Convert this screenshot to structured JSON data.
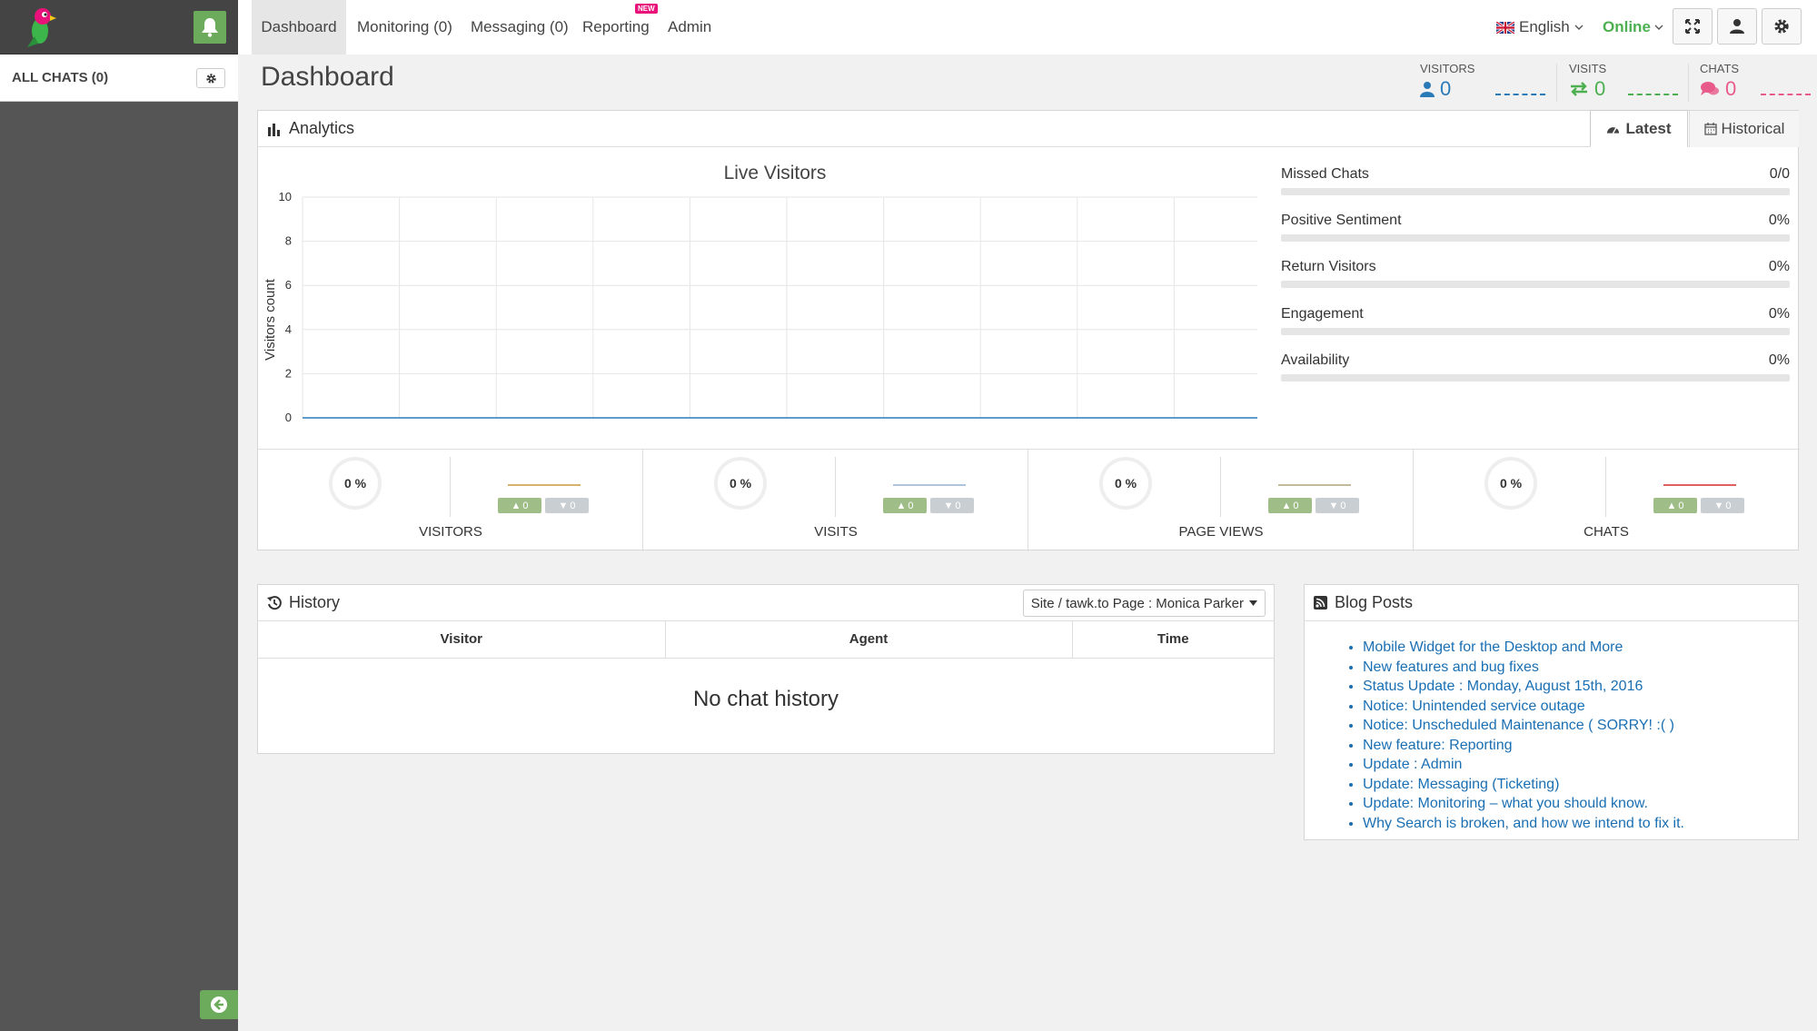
{
  "sidebar": {
    "all_chats_label": "ALL CHATS (0)"
  },
  "nav": {
    "tabs": [
      {
        "label": "Dashboard"
      },
      {
        "label": "Monitoring (0)"
      },
      {
        "label": "Messaging (0)"
      },
      {
        "label": "Reporting"
      },
      {
        "label": "Admin"
      }
    ],
    "new_badge": "NEW",
    "language": "English",
    "status": "Online"
  },
  "page_title": "Dashboard",
  "stats": {
    "visitors": {
      "label": "VISITORS",
      "value": "0",
      "color": "#2a7ab8"
    },
    "visits": {
      "label": "VISITS",
      "value": "0",
      "color": "#4caf50"
    },
    "chats": {
      "label": "CHATS",
      "value": "0",
      "color": "#e85a8a"
    }
  },
  "analytics": {
    "title": "Analytics",
    "tab_latest": "Latest",
    "tab_historical": "Historical",
    "metrics": [
      {
        "label": "Missed Chats",
        "value": "0/0"
      },
      {
        "label": "Positive Sentiment",
        "value": "0%"
      },
      {
        "label": "Return Visitors",
        "value": "0%"
      },
      {
        "label": "Engagement",
        "value": "0%"
      },
      {
        "label": "Availability",
        "value": "0%"
      }
    ],
    "kpis": [
      {
        "label": "VISITORS",
        "percent": "0 %",
        "up": "0",
        "down": "0",
        "spark_color": "#d9b26a"
      },
      {
        "label": "VISITS",
        "percent": "0 %",
        "up": "0",
        "down": "0",
        "spark_color": "#b0c4de"
      },
      {
        "label": "PAGE VIEWS",
        "percent": "0 %",
        "up": "0",
        "down": "0",
        "spark_color": "#c5b99b"
      },
      {
        "label": "CHATS",
        "percent": "0 %",
        "up": "0",
        "down": "0",
        "spark_color": "#e06060"
      }
    ]
  },
  "chart_data": {
    "type": "line",
    "title": "Live Visitors",
    "xlabel": "",
    "ylabel": "Visitors count",
    "ylim": [
      0,
      10
    ],
    "yticks": [
      0,
      2,
      4,
      6,
      8,
      10
    ],
    "grid": true,
    "x": [
      0,
      1,
      2,
      3,
      4,
      5,
      6,
      7,
      8,
      9,
      10
    ],
    "series": [
      {
        "values": [
          0,
          0,
          0,
          0,
          0,
          0,
          0,
          0,
          0,
          0,
          0
        ],
        "color": "#2a7ab8"
      }
    ]
  },
  "history": {
    "title": "History",
    "filter": "Site / tawk.to Page : Monica Parker",
    "columns": [
      "Visitor",
      "Agent",
      "Time"
    ],
    "empty_text": "No chat history"
  },
  "blog": {
    "title": "Blog Posts",
    "posts": [
      "Mobile Widget for the Desktop and More",
      "New features and bug fixes",
      "Status Update : Monday, August 15th, 2016",
      "Notice: Unintended service outage",
      "Notice: Unscheduled Maintenance ( SORRY! :( )",
      "New feature: Reporting",
      "Update : Admin",
      "Update: Messaging (Ticketing)",
      "Update: Monitoring – what you should know.",
      "Why Search is broken, and how we intend to fix it."
    ]
  }
}
